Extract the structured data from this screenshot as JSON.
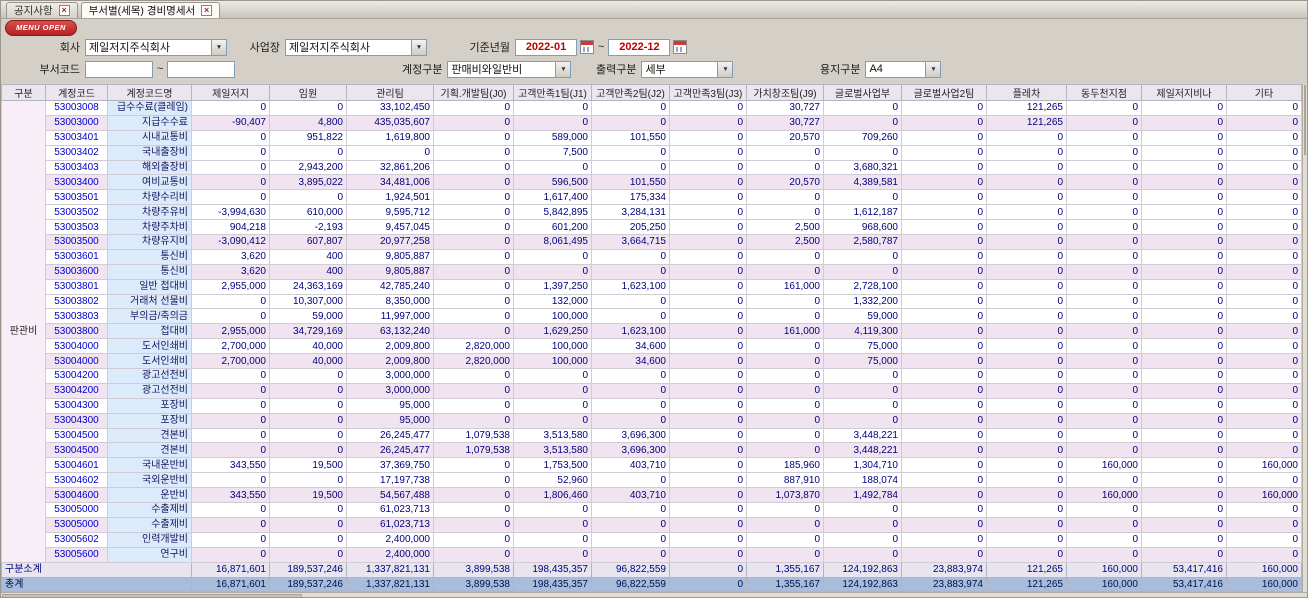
{
  "icons": {
    "close": "×",
    "dropdown": "▼"
  },
  "tabs": [
    {
      "label": "공지사항"
    },
    {
      "label": "부서별(세목) 경비명세서"
    }
  ],
  "menu_open_label": "MENU OPEN",
  "filters": {
    "company_label": "회사",
    "company_value": "제일저지주식회사",
    "site_label": "사업장",
    "site_value": "제일저지주식회사",
    "period_label": "기준년월",
    "period_from": "2022-01",
    "period_to": "2022-12",
    "tilde": "~",
    "dept_label": "부서코드",
    "dept_from": "",
    "dept_to": "",
    "account_label": "계정구분",
    "account_value": "판매비와일반비",
    "output_label": "출력구분",
    "output_value": "세부",
    "paper_label": "용지구분",
    "paper_value": "A4"
  },
  "colors": {
    "menu_open_red": "#c02424",
    "date_text_red": "#c00000",
    "code_blue": "#0000cc",
    "number_navy": "#00007d",
    "name_cell_blue": "#dcebfb",
    "subtotal_pink": "#f1e4f0",
    "total_row_blue": "#a9bdda",
    "header_bg": "#e9e6ee"
  },
  "table": {
    "group_label": "판관비",
    "columns": [
      "구분",
      "계정코드",
      "계정코드명",
      "제일저지",
      "임원",
      "관리팀",
      "기획.개발팀(J0)",
      "고객만족1팀(J1)",
      "고객만족2팀(J2)",
      "고객만족3팀(J3)",
      "가치창조팀(J9)",
      "글로벌사업부",
      "글로벌사업2팀",
      "플레차",
      "동두천지점",
      "제일저지비나",
      "기타"
    ],
    "rows": [
      {
        "code": "53003008",
        "name": "급수수료(클레임)",
        "subtotal": false,
        "values": [
          "0",
          "0",
          "33,102,450",
          "0",
          "0",
          "0",
          "0",
          "30,727",
          "0",
          "0",
          "121,265",
          "0",
          "0",
          "0"
        ]
      },
      {
        "code": "53003000",
        "name": "지급수수료",
        "subtotal": true,
        "values": [
          "-90,407",
          "4,800",
          "435,035,607",
          "0",
          "0",
          "0",
          "0",
          "30,727",
          "0",
          "0",
          "121,265",
          "0",
          "0",
          "0"
        ]
      },
      {
        "code": "53003401",
        "name": "시내교통비",
        "subtotal": false,
        "values": [
          "0",
          "951,822",
          "1,619,800",
          "0",
          "589,000",
          "101,550",
          "0",
          "20,570",
          "709,260",
          "0",
          "0",
          "0",
          "0",
          "0"
        ]
      },
      {
        "code": "53003402",
        "name": "국내출장비",
        "subtotal": false,
        "values": [
          "0",
          "0",
          "0",
          "0",
          "7,500",
          "0",
          "0",
          "0",
          "0",
          "0",
          "0",
          "0",
          "0",
          "0"
        ]
      },
      {
        "code": "53003403",
        "name": "해외출장비",
        "subtotal": false,
        "values": [
          "0",
          "2,943,200",
          "32,861,206",
          "0",
          "0",
          "0",
          "0",
          "0",
          "3,680,321",
          "0",
          "0",
          "0",
          "0",
          "0"
        ]
      },
      {
        "code": "53003400",
        "name": "여비교통비",
        "subtotal": true,
        "values": [
          "0",
          "3,895,022",
          "34,481,006",
          "0",
          "596,500",
          "101,550",
          "0",
          "20,570",
          "4,389,581",
          "0",
          "0",
          "0",
          "0",
          "0"
        ]
      },
      {
        "code": "53003501",
        "name": "차량수리비",
        "subtotal": false,
        "values": [
          "0",
          "0",
          "1,924,501",
          "0",
          "1,617,400",
          "175,334",
          "0",
          "0",
          "0",
          "0",
          "0",
          "0",
          "0",
          "0"
        ]
      },
      {
        "code": "53003502",
        "name": "차량주유비",
        "subtotal": false,
        "values": [
          "-3,994,630",
          "610,000",
          "9,595,712",
          "0",
          "5,842,895",
          "3,284,131",
          "0",
          "0",
          "1,612,187",
          "0",
          "0",
          "0",
          "0",
          "0"
        ]
      },
      {
        "code": "53003503",
        "name": "차량주차비",
        "subtotal": false,
        "values": [
          "904,218",
          "-2,193",
          "9,457,045",
          "0",
          "601,200",
          "205,250",
          "0",
          "2,500",
          "968,600",
          "0",
          "0",
          "0",
          "0",
          "0"
        ]
      },
      {
        "code": "53003500",
        "name": "차량유지비",
        "subtotal": true,
        "values": [
          "-3,090,412",
          "607,807",
          "20,977,258",
          "0",
          "8,061,495",
          "3,664,715",
          "0",
          "2,500",
          "2,580,787",
          "0",
          "0",
          "0",
          "0",
          "0"
        ]
      },
      {
        "code": "53003601",
        "name": "통신비",
        "subtotal": false,
        "values": [
          "3,620",
          "400",
          "9,805,887",
          "0",
          "0",
          "0",
          "0",
          "0",
          "0",
          "0",
          "0",
          "0",
          "0",
          "0"
        ]
      },
      {
        "code": "53003600",
        "name": "통신비",
        "subtotal": true,
        "values": [
          "3,620",
          "400",
          "9,805,887",
          "0",
          "0",
          "0",
          "0",
          "0",
          "0",
          "0",
          "0",
          "0",
          "0",
          "0"
        ]
      },
      {
        "code": "53003801",
        "name": "일반 접대비",
        "subtotal": false,
        "values": [
          "2,955,000",
          "24,363,169",
          "42,785,240",
          "0",
          "1,397,250",
          "1,623,100",
          "0",
          "161,000",
          "2,728,100",
          "0",
          "0",
          "0",
          "0",
          "0"
        ]
      },
      {
        "code": "53003802",
        "name": "거래처 선물비",
        "subtotal": false,
        "values": [
          "0",
          "10,307,000",
          "8,350,000",
          "0",
          "132,000",
          "0",
          "0",
          "0",
          "1,332,200",
          "0",
          "0",
          "0",
          "0",
          "0"
        ]
      },
      {
        "code": "53003803",
        "name": "부의금/축의금",
        "subtotal": false,
        "values": [
          "0",
          "59,000",
          "11,997,000",
          "0",
          "100,000",
          "0",
          "0",
          "0",
          "59,000",
          "0",
          "0",
          "0",
          "0",
          "0"
        ]
      },
      {
        "code": "53003800",
        "name": "접대비",
        "subtotal": true,
        "values": [
          "2,955,000",
          "34,729,169",
          "63,132,240",
          "0",
          "1,629,250",
          "1,623,100",
          "0",
          "161,000",
          "4,119,300",
          "0",
          "0",
          "0",
          "0",
          "0"
        ]
      },
      {
        "code": "53004000",
        "name": "도서인쇄비",
        "subtotal": false,
        "values": [
          "2,700,000",
          "40,000",
          "2,009,800",
          "2,820,000",
          "100,000",
          "34,600",
          "0",
          "0",
          "75,000",
          "0",
          "0",
          "0",
          "0",
          "0"
        ]
      },
      {
        "code": "53004000",
        "name": "도서인쇄비",
        "subtotal": true,
        "values": [
          "2,700,000",
          "40,000",
          "2,009,800",
          "2,820,000",
          "100,000",
          "34,600",
          "0",
          "0",
          "75,000",
          "0",
          "0",
          "0",
          "0",
          "0"
        ]
      },
      {
        "code": "53004200",
        "name": "광고선전비",
        "subtotal": false,
        "values": [
          "0",
          "0",
          "3,000,000",
          "0",
          "0",
          "0",
          "0",
          "0",
          "0",
          "0",
          "0",
          "0",
          "0",
          "0"
        ]
      },
      {
        "code": "53004200",
        "name": "광고선전비",
        "subtotal": true,
        "values": [
          "0",
          "0",
          "3,000,000",
          "0",
          "0",
          "0",
          "0",
          "0",
          "0",
          "0",
          "0",
          "0",
          "0",
          "0"
        ]
      },
      {
        "code": "53004300",
        "name": "포장비",
        "subtotal": false,
        "values": [
          "0",
          "0",
          "95,000",
          "0",
          "0",
          "0",
          "0",
          "0",
          "0",
          "0",
          "0",
          "0",
          "0",
          "0"
        ]
      },
      {
        "code": "53004300",
        "name": "포장비",
        "subtotal": true,
        "values": [
          "0",
          "0",
          "95,000",
          "0",
          "0",
          "0",
          "0",
          "0",
          "0",
          "0",
          "0",
          "0",
          "0",
          "0"
        ]
      },
      {
        "code": "53004500",
        "name": "견본비",
        "subtotal": false,
        "values": [
          "0",
          "0",
          "26,245,477",
          "1,079,538",
          "3,513,580",
          "3,696,300",
          "0",
          "0",
          "3,448,221",
          "0",
          "0",
          "0",
          "0",
          "0"
        ]
      },
      {
        "code": "53004500",
        "name": "견본비",
        "subtotal": true,
        "values": [
          "0",
          "0",
          "26,245,477",
          "1,079,538",
          "3,513,580",
          "3,696,300",
          "0",
          "0",
          "3,448,221",
          "0",
          "0",
          "0",
          "0",
          "0"
        ]
      },
      {
        "code": "53004601",
        "name": "국내운반비",
        "subtotal": false,
        "values": [
          "343,550",
          "19,500",
          "37,369,750",
          "0",
          "1,753,500",
          "403,710",
          "0",
          "185,960",
          "1,304,710",
          "0",
          "0",
          "160,000",
          "0",
          "160,000"
        ]
      },
      {
        "code": "53004602",
        "name": "국외운반비",
        "subtotal": false,
        "values": [
          "0",
          "0",
          "17,197,738",
          "0",
          "52,960",
          "0",
          "0",
          "887,910",
          "188,074",
          "0",
          "0",
          "0",
          "0",
          "0"
        ]
      },
      {
        "code": "53004600",
        "name": "운반비",
        "subtotal": true,
        "values": [
          "343,550",
          "19,500",
          "54,567,488",
          "0",
          "1,806,460",
          "403,710",
          "0",
          "1,073,870",
          "1,492,784",
          "0",
          "0",
          "160,000",
          "0",
          "160,000"
        ]
      },
      {
        "code": "53005000",
        "name": "수출제비",
        "subtotal": false,
        "values": [
          "0",
          "0",
          "61,023,713",
          "0",
          "0",
          "0",
          "0",
          "0",
          "0",
          "0",
          "0",
          "0",
          "0",
          "0"
        ]
      },
      {
        "code": "53005000",
        "name": "수출제비",
        "subtotal": true,
        "values": [
          "0",
          "0",
          "61,023,713",
          "0",
          "0",
          "0",
          "0",
          "0",
          "0",
          "0",
          "0",
          "0",
          "0",
          "0"
        ]
      },
      {
        "code": "53005602",
        "name": "인력개발비",
        "subtotal": false,
        "values": [
          "0",
          "0",
          "2,400,000",
          "0",
          "0",
          "0",
          "0",
          "0",
          "0",
          "0",
          "0",
          "0",
          "0",
          "0"
        ]
      },
      {
        "code": "53005600",
        "name": "연구비",
        "subtotal": true,
        "values": [
          "0",
          "0",
          "2,400,000",
          "0",
          "0",
          "0",
          "0",
          "0",
          "0",
          "0",
          "0",
          "0",
          "0",
          "0"
        ]
      }
    ],
    "footer": [
      {
        "label": "구분소계",
        "total": false,
        "values": [
          "16,871,601",
          "189,537,246",
          "1,337,821,131",
          "3,899,538",
          "198,435,357",
          "96,822,559",
          "0",
          "1,355,167",
          "124,192,863",
          "23,883,974",
          "121,265",
          "160,000",
          "53,417,416",
          "160,000"
        ]
      },
      {
        "label": "총계",
        "total": true,
        "values": [
          "16,871,601",
          "189,537,246",
          "1,337,821,131",
          "3,899,538",
          "198,435,357",
          "96,822,559",
          "0",
          "1,355,167",
          "124,192,863",
          "23,883,974",
          "121,265",
          "160,000",
          "53,417,416",
          "160,000"
        ]
      }
    ]
  }
}
